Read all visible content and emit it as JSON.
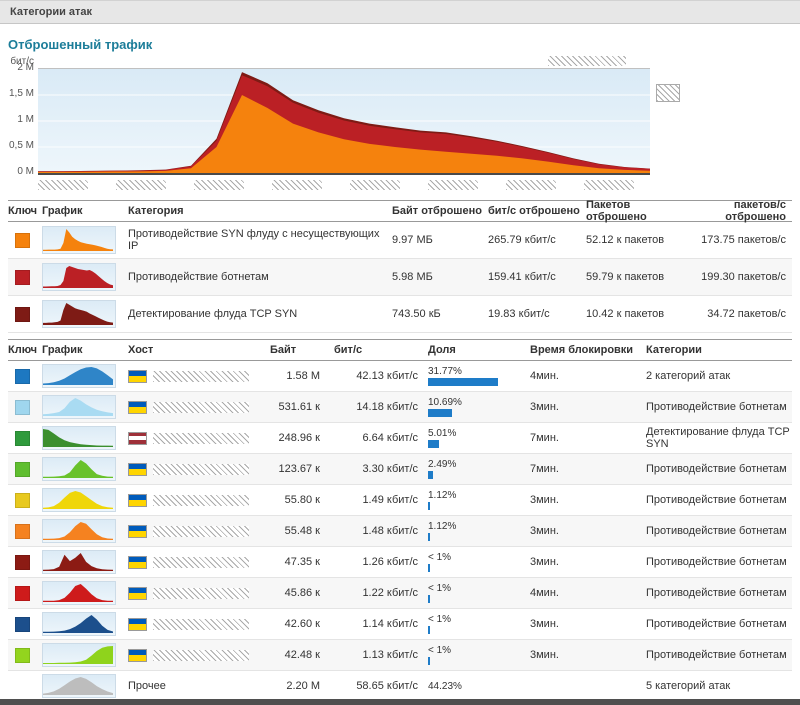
{
  "title_bar": {
    "label": "Категории атак"
  },
  "section": {
    "title": "Отброшенный трафик"
  },
  "chart_data": {
    "type": "area",
    "stacked": true,
    "ylabel": "бит/с",
    "ylim": [
      0,
      2000000
    ],
    "yticks": [
      "2 M",
      "1,5 M",
      "1 M",
      "0,5 M",
      "0 M"
    ],
    "grid": true,
    "x_labels_redacted": true,
    "series": [
      {
        "name": "Противодействие SYN флуду с несуществующих IP",
        "color": "#f5820d",
        "values": [
          20000,
          22000,
          25000,
          28000,
          30000,
          40000,
          90000,
          500000,
          1500000,
          1250000,
          950000,
          780000,
          650000,
          560000,
          500000,
          450000,
          410000,
          370000,
          330000,
          280000,
          220000,
          150000,
          90000,
          60000,
          45000
        ]
      },
      {
        "name": "Противодействие ботнетам",
        "color": "#bb2025",
        "values": [
          10000,
          10000,
          12000,
          14000,
          16000,
          20000,
          40000,
          120000,
          380000,
          420000,
          400000,
          380000,
          360000,
          350000,
          340000,
          330000,
          340000,
          310000,
          270000,
          220000,
          170000,
          120000,
          80000,
          50000,
          35000
        ]
      },
      {
        "name": "Детектирование флуда TCP SYN",
        "color": "#7e1b15",
        "values": [
          3000,
          3000,
          4000,
          4000,
          5000,
          6000,
          10000,
          40000,
          60000,
          55000,
          50000,
          45000,
          42000,
          40000,
          38000,
          35000,
          30000,
          26000,
          22000,
          18000,
          14000,
          10000,
          7000,
          5000,
          4000
        ]
      }
    ]
  },
  "categories_table": {
    "headers": [
      "Ключ",
      "График",
      "Категория",
      "Байт отброшено",
      "бит/с отброшено",
      "Пакетов отброшено",
      "пакетов/с отброшено"
    ],
    "rows": [
      {
        "key_color": "#f5820d",
        "category": "Противодействие SYN флуду с несуществующих IP",
        "bytes": "9.97 МБ",
        "bps": "265.79 кбит/с",
        "packets": "52.12 к пакетов",
        "pps": "173.75 пакетов/с"
      },
      {
        "key_color": "#bb2025",
        "category": "Противодействие ботнетам",
        "bytes": "5.98 МБ",
        "bps": "159.41 кбит/с",
        "packets": "59.79 к пакетов",
        "pps": "199.30 пакетов/с"
      },
      {
        "key_color": "#7e1b15",
        "category": "Детектирование флуда TCP SYN",
        "bytes": "743.50 кБ",
        "bps": "19.83 кбит/с",
        "packets": "10.42 к пакетов",
        "pps": "34.72 пакетов/с"
      }
    ]
  },
  "hosts_table": {
    "headers": [
      "Ключ",
      "График",
      "Хост",
      "Байт",
      "бит/с",
      "Доля",
      "Время блокировки",
      "Категории"
    ],
    "rows": [
      {
        "key_color": "#1d78c1",
        "spark_color": "#2f85c8",
        "spark": [
          2,
          4,
          8,
          14,
          24,
          38,
          52,
          64,
          72,
          74,
          68,
          55,
          38,
          20
        ],
        "flag": [
          "#005bbb",
          "#ffd500"
        ],
        "host": null,
        "bytes": "1.58 M",
        "bps": "42.13 кбит/с",
        "share": "31.77%",
        "share_pct": 31.77,
        "time": "4мин.",
        "category": "2 категорий атак"
      },
      {
        "key_color": "#9fd6ee",
        "spark_color": "#a9dbf2",
        "spark": [
          2,
          3,
          5,
          8,
          18,
          35,
          45,
          38,
          28,
          20,
          14,
          10,
          7,
          5
        ],
        "flag": [
          "#005bbb",
          "#ffd500"
        ],
        "host": null,
        "bytes": "531.61 к",
        "bps": "14.18 кбит/с",
        "share": "10.69%",
        "share_pct": 10.69,
        "time": "3мин.",
        "category": "Противодействие ботнетам"
      },
      {
        "key_color": "#2f9a3c",
        "spark_color": "#3c8f2f",
        "spark": [
          95,
          90,
          70,
          48,
          32,
          22,
          15,
          10,
          7,
          5,
          3,
          2,
          2,
          1
        ],
        "flag": [
          "#9e3039",
          "#ffffff",
          "#9e3039"
        ],
        "host": null,
        "bytes": "248.96 к",
        "bps": "6.64 кбит/с",
        "share": "5.01%",
        "share_pct": 5.01,
        "time": "7мин.",
        "category": "Детектирование флуда TCP SYN"
      },
      {
        "key_color": "#5fbe2f",
        "spark_color": "#69c22b",
        "spark": [
          1,
          1,
          2,
          4,
          8,
          25,
          60,
          88,
          70,
          40,
          15,
          6,
          2,
          1
        ],
        "flag": [
          "#005bbb",
          "#ffd500"
        ],
        "host": null,
        "bytes": "123.67 к",
        "bps": "3.30 кбит/с",
        "share": "2.49%",
        "share_pct": 2.49,
        "time": "7мин.",
        "category": "Противодействие ботнетам"
      },
      {
        "key_color": "#e8c91f",
        "spark_color": "#efd60a",
        "spark": [
          1,
          3,
          10,
          28,
          55,
          80,
          90,
          82,
          62,
          42,
          22,
          10,
          4,
          1
        ],
        "flag": [
          "#005bbb",
          "#ffd500"
        ],
        "host": null,
        "bytes": "55.80 к",
        "bps": "1.49 кбит/с",
        "share": "1.12%",
        "share_pct": 1.12,
        "time": "3мин.",
        "category": "Противодействие ботнетам"
      },
      {
        "key_color": "#f58220",
        "spark_color": "#f58220",
        "spark": [
          1,
          1,
          2,
          5,
          14,
          38,
          72,
          95,
          85,
          55,
          26,
          10,
          3,
          1
        ],
        "flag": [
          "#005bbb",
          "#ffd500"
        ],
        "host": null,
        "bytes": "55.48 к",
        "bps": "1.48 кбит/с",
        "share": "1.12%",
        "share_pct": 1.12,
        "time": "3мин.",
        "category": "Противодействие ботнетам"
      },
      {
        "key_color": "#8c1b14",
        "spark_color": "#8c1b14",
        "spark": [
          1,
          2,
          5,
          18,
          85,
          50,
          68,
          95,
          45,
          22,
          10,
          4,
          2,
          1
        ],
        "flag": [
          "#005bbb",
          "#ffd500"
        ],
        "host": null,
        "bytes": "47.35 к",
        "bps": "1.26 кбит/с",
        "share": "< 1%",
        "share_pct": 0.9,
        "time": "3мин.",
        "category": "Противодействие ботнетам"
      },
      {
        "key_color": "#ce1b1b",
        "spark_color": "#ce1b1b",
        "spark": [
          1,
          1,
          2,
          5,
          18,
          48,
          88,
          100,
          72,
          40,
          16,
          5,
          2,
          1
        ],
        "flag": [
          "#005bbb",
          "#ffd500"
        ],
        "host": null,
        "bytes": "45.86 к",
        "bps": "1.22 кбит/с",
        "share": "< 1%",
        "share_pct": 0.9,
        "time": "4мин.",
        "category": "Противодействие ботнетам"
      },
      {
        "key_color": "#1c4f8c",
        "spark_color": "#1c4f8c",
        "spark": [
          1,
          1,
          2,
          4,
          8,
          16,
          30,
          50,
          75,
          95,
          70,
          35,
          12,
          3
        ],
        "flag": [
          "#005bbb",
          "#ffd500"
        ],
        "host": null,
        "bytes": "42.60 к",
        "bps": "1.14 кбит/с",
        "share": "< 1%",
        "share_pct": 0.9,
        "time": "3мин.",
        "category": "Противодействие ботнетам"
      },
      {
        "key_color": "#93d41e",
        "spark_color": "#8fd31c",
        "spark": [
          0,
          0,
          0,
          1,
          1,
          2,
          4,
          8,
          18,
          40,
          65,
          82,
          90,
          92
        ],
        "flag": [
          "#005bbb",
          "#ffd500"
        ],
        "host": null,
        "bytes": "42.48 к",
        "bps": "1.13 кбит/с",
        "share": "< 1%",
        "share_pct": 0.9,
        "time": "3мин.",
        "category": "Противодействие ботнетам"
      },
      {
        "key_color": null,
        "spark_color": "#bdbdbd",
        "spark": [
          2,
          6,
          14,
          28,
          46,
          66,
          82,
          90,
          80,
          62,
          42,
          26,
          13,
          5
        ],
        "flag": null,
        "host": "Прочее",
        "bytes": "2.20 M",
        "bps": "58.65 кбит/с",
        "share": "44.23%",
        "share_pct": null,
        "time": "",
        "category": "5 категорий атак"
      }
    ]
  }
}
